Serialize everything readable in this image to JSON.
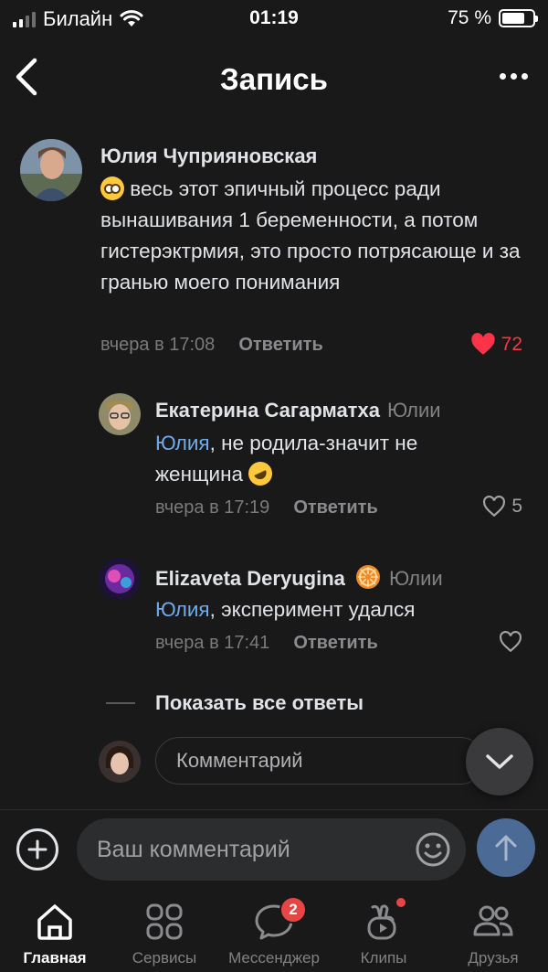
{
  "status_bar": {
    "carrier": "Билайн",
    "time": "01:19",
    "battery": "75 %",
    "battery_level": 0.75
  },
  "header": {
    "title": "Запись"
  },
  "comments": [
    {
      "author": "Юлия Чуприяновская",
      "text": "весь этот эпичный процесс ради вынашивания 1 беременности, а потом гистерэктрмия, это просто потрясающе и за гранью моего понимания",
      "time": "вчера в 17:08",
      "reply_label": "Ответить",
      "likes": "72",
      "liked": true,
      "emoji": "flushed-face-emoji"
    },
    {
      "author": "Екатерина Сагарматха",
      "reply_to": "Юлии",
      "mention": "Юлия",
      "text": ", не родила-значит не женщина",
      "time": "вчера в 17:19",
      "reply_label": "Ответить",
      "likes": "5",
      "liked": false,
      "emoji": "rofl-emoji"
    },
    {
      "author": "Elizaveta Deryugina",
      "reply_to": "Юлии",
      "mention": "Юлия",
      "text": ", эксперимент удался",
      "time": "вчера в 17:41",
      "reply_label": "Ответить",
      "likes": "",
      "liked": false,
      "badge_icon": "orange-wheel-emoji"
    }
  ],
  "show_all_replies": "Показать все ответы",
  "reply_input": {
    "placeholder": "Комментарий"
  },
  "composer": {
    "placeholder": "Ваш комментарий"
  },
  "tabs": [
    {
      "label": "Главная",
      "icon": "home-icon",
      "active": true
    },
    {
      "label": "Сервисы",
      "icon": "services-grid-icon",
      "active": false
    },
    {
      "label": "Мессенджер",
      "icon": "messenger-icon",
      "active": false,
      "badge": "2"
    },
    {
      "label": "Клипы",
      "icon": "clips-icon",
      "active": false,
      "dot": true
    },
    {
      "label": "Друзья",
      "icon": "friends-icon",
      "active": false
    }
  ],
  "colors": {
    "background": "#19191a",
    "accent": "#71aaeb",
    "like": "#ff3347",
    "badge": "#e64646"
  }
}
